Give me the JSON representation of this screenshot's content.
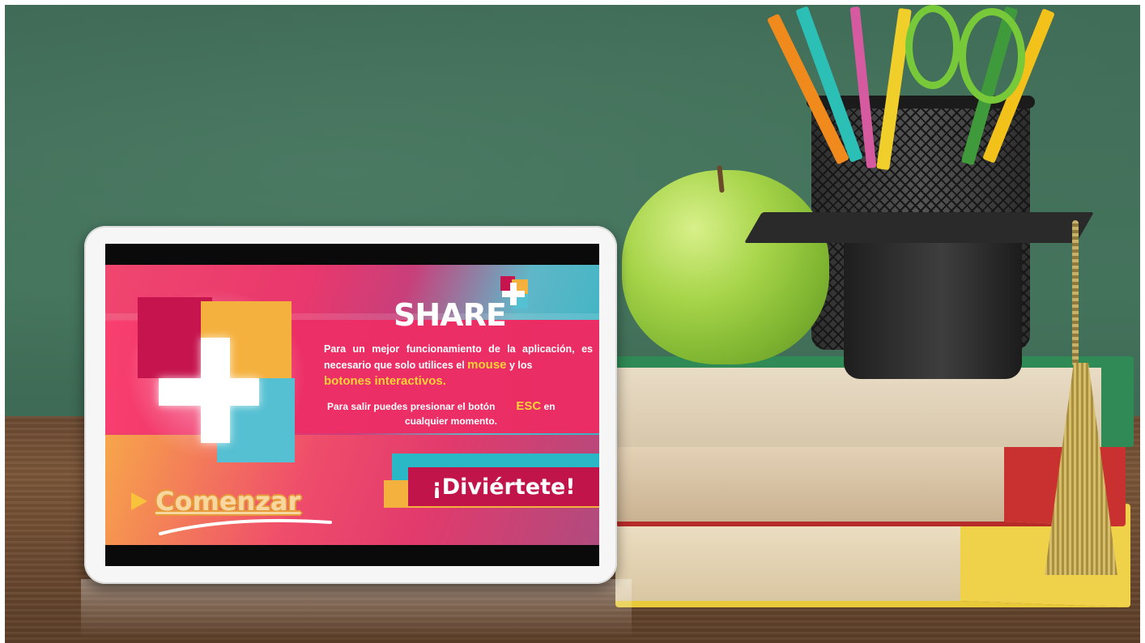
{
  "app": {
    "logo_text": "SHARE",
    "instructions": {
      "part1": "Para un mejor funcionamiento de la aplicación, es necesario que solo utilices el ",
      "highlight1": "mouse",
      "part2": " y los ",
      "highlight2": "botones interactivos."
    },
    "exit_note": {
      "before": "Para salir puedes presionar el botón",
      "key": "ESC",
      "after1": " en",
      "line2": "cualquier momento."
    },
    "fun_label": "¡Diviértete!",
    "start_button_label": "Comenzar",
    "colors": {
      "primary_pink": "#ec2f66",
      "dark_magenta": "#c0144a",
      "orange": "#f5b13d",
      "teal": "#2bb8c6",
      "highlight_yellow": "#f8d237"
    }
  },
  "icons": [
    "play-arrow-icon",
    "plus-logo-icon"
  ]
}
